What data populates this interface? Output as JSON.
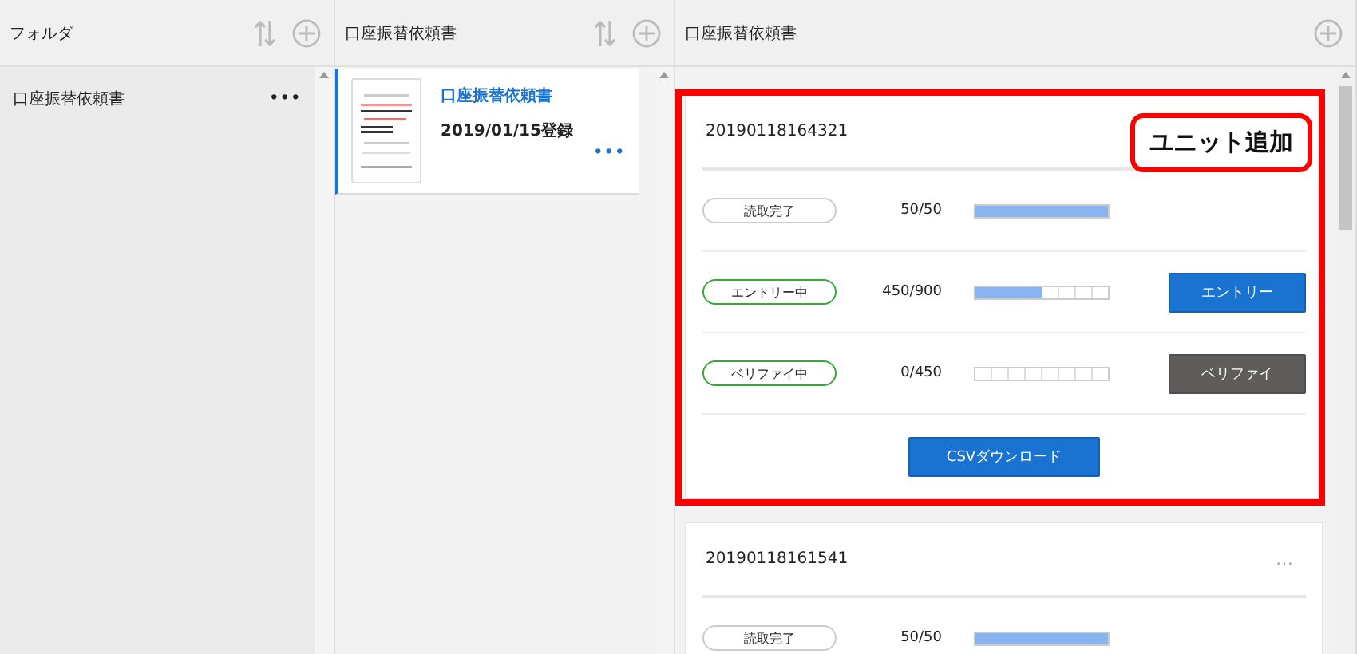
{
  "folders": {
    "title": "フォルダ",
    "items": [
      {
        "label": "口座振替依頼書",
        "menu": "•••",
        "selected": false
      }
    ]
  },
  "documents": {
    "title": "口座振替依頼書",
    "items": [
      {
        "kind": "picture",
        "title": "口座振替依頼書",
        "date": "2019/01/15登録",
        "menu": "•••",
        "selected": true
      }
    ]
  },
  "units": {
    "title": "口座振替依頼書",
    "cards": [
      {
        "id": "20190118164321",
        "highlighted": true,
        "rows": [
          {
            "status": "読取完了",
            "kind": "done",
            "count": "50/50",
            "level": 1
          },
          {
            "status": "エントリー中",
            "kind": "active",
            "count": "450/900",
            "level": 0.5,
            "button": {
              "label": "エントリー",
              "kind": "primary"
            }
          },
          {
            "status": "ベリファイ中",
            "kind": "active",
            "count": "0/450",
            "level": 0,
            "button": {
              "label": "ベリファイ",
              "kind": "secondary"
            }
          }
        ],
        "download": "CSVダウンロード"
      },
      {
        "id": "20190118161541",
        "highlighted": false,
        "menu": "…",
        "rows": [
          {
            "status": "読取完了",
            "kind": "done",
            "count": "50/50",
            "level": 1
          }
        ]
      }
    ]
  },
  "annotation": {
    "label": "ユニット追加"
  }
}
